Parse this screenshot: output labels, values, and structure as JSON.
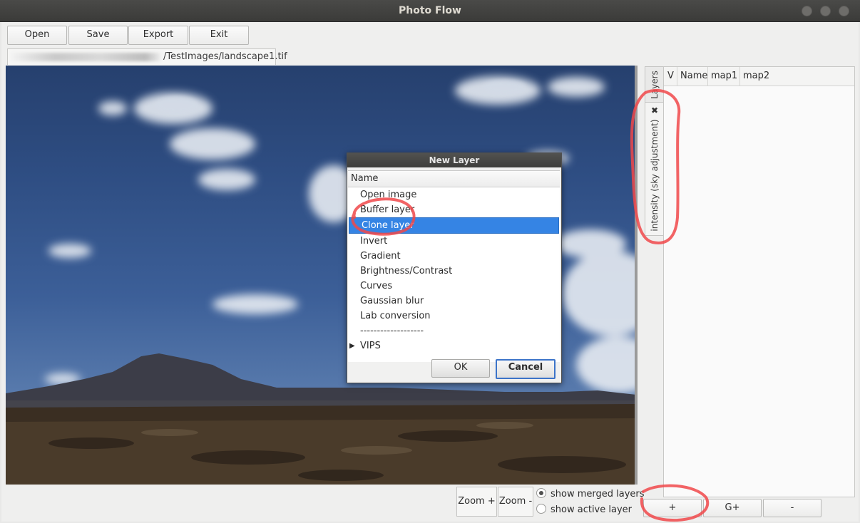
{
  "window": {
    "title": "Photo Flow"
  },
  "toolbar": {
    "open": "Open",
    "save": "Save",
    "export": "Export",
    "exit": "Exit"
  },
  "file_tab": {
    "path": "/TestImages/landscape1.tif"
  },
  "dialog": {
    "title": "New Layer",
    "column_header": "Name",
    "items": [
      {
        "label": "Open image"
      },
      {
        "label": "Buffer layer"
      },
      {
        "label": "Clone layer",
        "selected": true
      },
      {
        "label": "Invert"
      },
      {
        "label": "Gradient"
      },
      {
        "label": "Brightness/Contrast"
      },
      {
        "label": "Curves"
      },
      {
        "label": "Gaussian blur"
      },
      {
        "label": "Lab conversion"
      },
      {
        "label": "-------------------"
      }
    ],
    "group": {
      "label": "VIPS"
    },
    "ok_label": "OK",
    "cancel_label": "Cancel"
  },
  "right_panel": {
    "tab_layers": "Layers",
    "tab_intensity": "intensity (sky adjustment)",
    "columns": {
      "v": "V",
      "name": "Name",
      "map1": "map1",
      "map2": "map2"
    },
    "buttons": {
      "add": "+",
      "group": "G+",
      "remove": "-"
    }
  },
  "view_controls": {
    "zoom_in": "Zoom +",
    "zoom_out": "Zoom -",
    "show_merged": "show merged layers",
    "show_active": "show active layer"
  },
  "colors": {
    "selection": "#3584e4",
    "annotation": "#f0484a"
  }
}
